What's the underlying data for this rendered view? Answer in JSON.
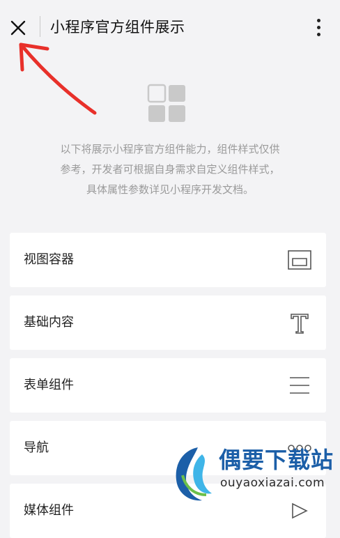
{
  "header": {
    "title": "小程序官方组件展示",
    "close_icon": "close-icon",
    "more_icon": "more-vertical-icon"
  },
  "intro": {
    "icon": "grid-squares-icon",
    "lines": [
      "以下将展示小程序官方组件能力，组件样式仅供",
      "参考，开发者可根据自身需求自定义组件样式，",
      "具体属性参数详见小程序开发文档。"
    ]
  },
  "sections": [
    {
      "label": "视图容器",
      "icon": "view-container-icon"
    },
    {
      "label": "基础内容",
      "icon": "text-t-icon"
    },
    {
      "label": "表单组件",
      "icon": "form-lines-icon"
    },
    {
      "label": "导航",
      "icon": "three-circles-icon"
    },
    {
      "label": "媒体组件",
      "icon": "media-icon"
    }
  ],
  "watermark": {
    "title": "偶要下载站",
    "url": "ouyaoxiazai.com"
  },
  "colors": {
    "background": "#f3f3f5",
    "card": "#ffffff",
    "annotation": "#e8302a",
    "watermark_blue": "#1c5fa8"
  }
}
